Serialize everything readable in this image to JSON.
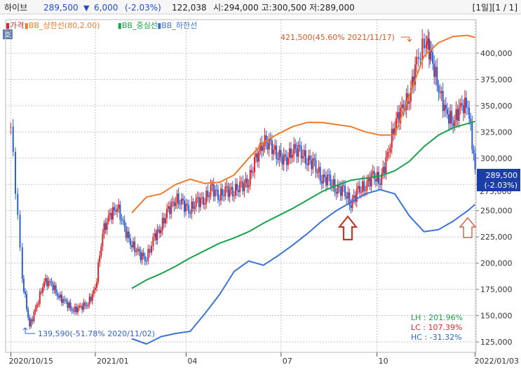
{
  "header": {
    "name": "하이브",
    "price": "289,500",
    "change_arrow": "▼",
    "change": "6,000",
    "change_pct": "(-2.03%)",
    "volume": "122,038",
    "ohl": "시:294,000 고:300,500 저:289,000",
    "period_page": "[1일][1 / 1]"
  },
  "legend": {
    "items": [
      {
        "marker": "▮",
        "label": "가격",
        "color": "#d9262a"
      },
      {
        "marker": "▮",
        "label": "BB_상한선(80,2.00)",
        "color": "#ee7b2b"
      },
      {
        "marker": "▮",
        "label": "BB_중심선",
        "color": "#19a34a"
      },
      {
        "marker": "▮",
        "label": "BB_하한선",
        "color": "#3c73d8"
      }
    ],
    "corner_tab": "호"
  },
  "annotations": {
    "high": "421,500(45.60% 2021/11/17)",
    "low": "139,590(-51.78% 2020/11/02)",
    "stats": {
      "lh": "LH :  201.96%",
      "lc": "LC :  107.39%",
      "hc": "HC :  -31.32%"
    }
  },
  "price_box": {
    "price": "289,500",
    "pct": "(-2.03%)",
    "partial_label": "275,000"
  },
  "colors": {
    "up": "#d9262a",
    "down": "#2b5fcf",
    "upper": "#ee7b2b",
    "middle": "#19a34a",
    "lower": "#3c73d8",
    "grid": "#c4c4c4",
    "price_bg": "#1b3fa6",
    "arrow": "#c0392b"
  },
  "chart_data": {
    "type": "line",
    "x_ticks": [
      "2020/10/15",
      "2021/01",
      "04",
      "07",
      "10",
      "2022/01/03"
    ],
    "y_ticks": [
      125000,
      150000,
      175000,
      200000,
      225000,
      250000,
      275000,
      300000,
      325000,
      350000,
      375000,
      400000
    ],
    "y_tick_labels": [
      "125,000",
      "150,000",
      "175,000",
      "200,000",
      "225,000",
      "250,000",
      "275,000",
      "300,000",
      "325,000",
      "350,000",
      "375,000",
      "400,000"
    ],
    "ylim": [
      115000,
      432000
    ],
    "grid": true,
    "series": [
      {
        "name": "가격",
        "x": [
          "2020/10/15",
          "2020/10/26",
          "2020/11/02",
          "2020/11/09",
          "2020/11/16",
          "2020/11/23",
          "2020/11/30",
          "2020/12/07",
          "2020/12/14",
          "2020/12/21",
          "2020/12/28",
          "2021/01/04",
          "2021/01/11",
          "2021/01/18",
          "2021/01/25",
          "2021/02/01",
          "2021/02/08",
          "2021/02/15",
          "2021/02/22",
          "2021/03/02",
          "2021/03/08",
          "2021/03/15",
          "2021/03/22",
          "2021/03/29",
          "2021/04/05",
          "2021/04/12",
          "2021/04/19",
          "2021/04/26",
          "2021/05/03",
          "2021/05/10",
          "2021/05/17",
          "2021/05/24",
          "2021/05/31",
          "2021/06/07",
          "2021/06/14",
          "2021/06/21",
          "2021/06/28",
          "2021/07/05",
          "2021/07/12",
          "2021/07/19",
          "2021/07/26",
          "2021/08/02",
          "2021/08/09",
          "2021/08/16",
          "2021/08/23",
          "2021/08/30",
          "2021/09/06",
          "2021/09/13",
          "2021/09/20",
          "2021/09/27",
          "2021/10/04",
          "2021/10/11",
          "2021/10/18",
          "2021/10/25",
          "2021/11/01",
          "2021/11/08",
          "2021/11/17",
          "2021/11/22",
          "2021/11/29",
          "2021/12/06",
          "2021/12/13",
          "2021/12/20",
          "2021/12/27",
          "2022/01/03"
        ],
        "values": [
          330000,
          185000,
          140000,
          160000,
          183000,
          180000,
          168000,
          162000,
          155000,
          158000,
          162000,
          175000,
          230000,
          245000,
          255000,
          232000,
          218000,
          208000,
          205000,
          225000,
          235000,
          250000,
          262000,
          255000,
          252000,
          258000,
          262000,
          270000,
          265000,
          268000,
          270000,
          272000,
          280000,
          298000,
          318000,
          310000,
          305000,
          295000,
          310000,
          305000,
          300000,
          292000,
          282000,
          278000,
          272000,
          268000,
          258000,
          268000,
          275000,
          282000,
          280000,
          300000,
          335000,
          345000,
          360000,
          390000,
          415000,
          395000,
          368000,
          342000,
          335000,
          348000,
          352000,
          289500
        ]
      },
      {
        "name": "BB_상한선(80,2.00)",
        "x": [
          "2021/02/08",
          "2021/02/22",
          "2021/03/08",
          "2021/03/22",
          "2021/04/05",
          "2021/04/19",
          "2021/05/03",
          "2021/05/17",
          "2021/05/31",
          "2021/06/14",
          "2021/06/28",
          "2021/07/12",
          "2021/07/26",
          "2021/08/09",
          "2021/08/23",
          "2021/09/06",
          "2021/09/20",
          "2021/10/04",
          "2021/10/18",
          "2021/11/01",
          "2021/11/15",
          "2021/11/29",
          "2021/12/13",
          "2021/12/27",
          "2022/01/03"
        ],
        "values": [
          248000,
          263000,
          266000,
          275000,
          280000,
          276000,
          277000,
          284000,
          300000,
          315000,
          323000,
          330000,
          334000,
          334000,
          332000,
          330000,
          325000,
          322000,
          322000,
          360000,
          397000,
          410000,
          416000,
          417000,
          415000
        ]
      },
      {
        "name": "BB_중심선",
        "x": [
          "2021/02/08",
          "2021/02/22",
          "2021/03/08",
          "2021/03/22",
          "2021/04/05",
          "2021/04/19",
          "2021/05/03",
          "2021/05/17",
          "2021/05/31",
          "2021/06/14",
          "2021/06/28",
          "2021/07/12",
          "2021/07/26",
          "2021/08/09",
          "2021/08/23",
          "2021/09/06",
          "2021/09/20",
          "2021/10/04",
          "2021/10/18",
          "2021/11/01",
          "2021/11/15",
          "2021/11/29",
          "2021/12/13",
          "2021/12/27",
          "2022/01/03"
        ],
        "values": [
          176000,
          184000,
          190000,
          197000,
          205000,
          212000,
          219000,
          224000,
          230000,
          238000,
          245000,
          252000,
          260000,
          268000,
          274000,
          279000,
          281000,
          283000,
          288000,
          297000,
          311000,
          322000,
          329000,
          333000,
          335000
        ]
      },
      {
        "name": "BB_하한선",
        "x": [
          "2021/02/08",
          "2021/02/22",
          "2021/03/08",
          "2021/03/22",
          "2021/04/05",
          "2021/04/19",
          "2021/05/03",
          "2021/05/17",
          "2021/05/31",
          "2021/06/14",
          "2021/06/28",
          "2021/07/12",
          "2021/07/26",
          "2021/08/09",
          "2021/08/23",
          "2021/09/06",
          "2021/09/20",
          "2021/10/04",
          "2021/10/18",
          "2021/11/01",
          "2021/11/15",
          "2021/11/29",
          "2021/12/13",
          "2021/12/27",
          "2022/01/03"
        ],
        "values": [
          128000,
          123000,
          130000,
          133000,
          135000,
          152000,
          170000,
          192000,
          202000,
          198000,
          207000,
          217000,
          228000,
          240000,
          250000,
          258000,
          266000,
          270000,
          266000,
          245000,
          230000,
          232000,
          240000,
          250000,
          256000
        ]
      }
    ]
  }
}
